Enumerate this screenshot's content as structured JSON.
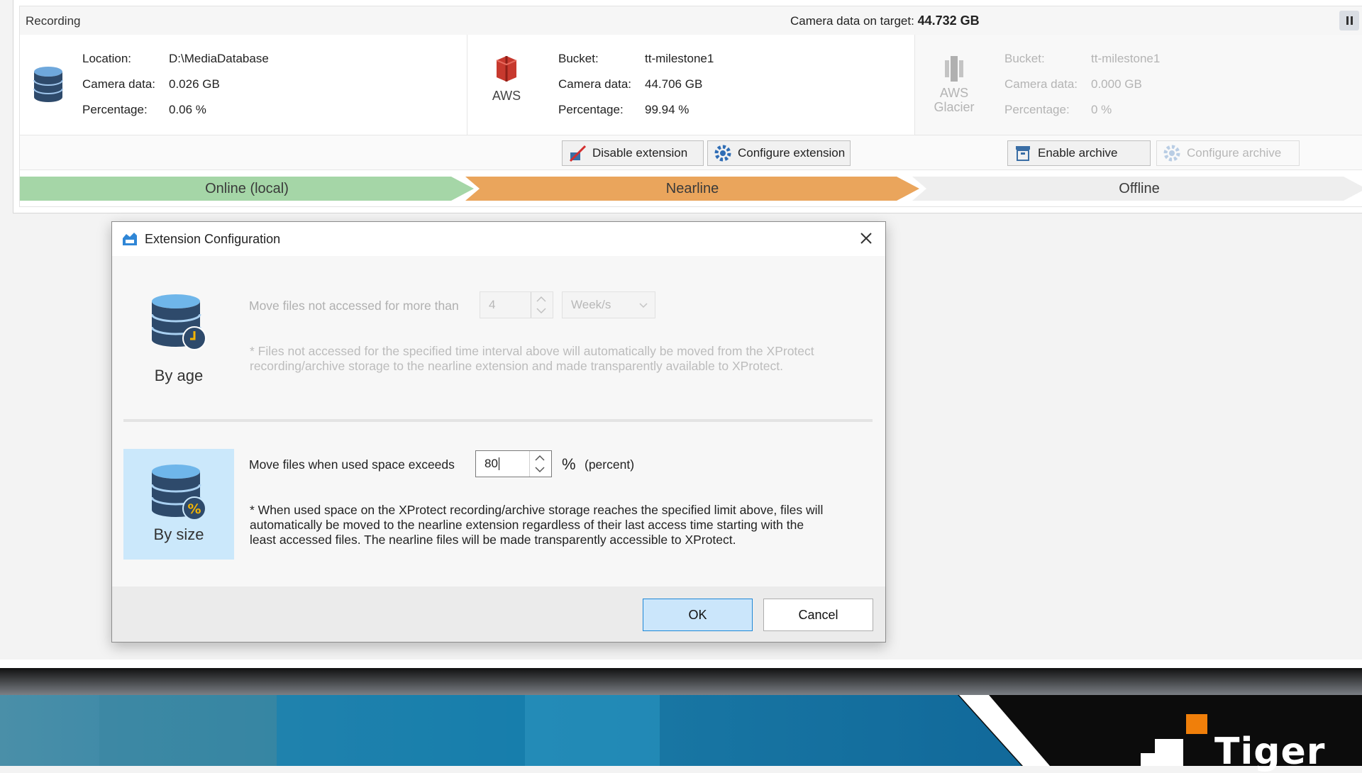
{
  "recording": {
    "title": "Recording",
    "total_label": "Camera data on target:",
    "total_value": "44.732 GB",
    "local": {
      "location_label": "Location:",
      "location_value": "D:\\MediaDatabase",
      "camera_label": "Camera data:",
      "camera_value": "0.026 GB",
      "pct_label": "Percentage:",
      "pct_value": "0.06 %"
    },
    "nearline": {
      "provider": "AWS",
      "bucket_label": "Bucket:",
      "bucket_value": "tt-milestone1",
      "camera_label": "Camera data:",
      "camera_value": "44.706 GB",
      "pct_label": "Percentage:",
      "pct_value": "99.94 %"
    },
    "offline": {
      "provider_line1": "AWS",
      "provider_line2": "Glacier",
      "bucket_label": "Bucket:",
      "bucket_value": "tt-milestone1",
      "camera_label": "Camera data:",
      "camera_value": "0.000 GB",
      "pct_label": "Percentage:",
      "pct_value": "0 %"
    },
    "buttons": {
      "disable_extension": "Disable extension",
      "configure_extension": "Configure extension",
      "enable_archive": "Enable archive",
      "configure_archive": "Configure archive"
    },
    "tiers": {
      "local": "Online (local)",
      "nearline": "Nearline",
      "offline": "Offline"
    },
    "colors": {
      "online": "#a5d6a7",
      "nearline": "#eaa55c",
      "offline": "#eeeeee"
    }
  },
  "dialog": {
    "title": "Extension Configuration",
    "by_age": {
      "label": "By age",
      "text": "Move files not accessed for more than",
      "value": "4",
      "unit": "Week/s",
      "note_line1": "* Files not accessed for the specified time interval above will automatically be moved from the XProtect",
      "note_line2": "recording/archive storage to the nearline extension and made transparently available to XProtect."
    },
    "by_size": {
      "label": "By size",
      "text": "Move files when used space exceeds",
      "value": "80",
      "unit_symbol": "%",
      "unit_text": "(percent)",
      "note_line1": "* When used space on the XProtect recording/archive storage reaches the specified limit above, files will",
      "note_line2": "automatically be moved to the nearline extension regardless of their last access time starting with the",
      "note_line3": "least accessed files. The nearline files will be made transparently accessible to XProtect."
    },
    "ok": "OK",
    "cancel": "Cancel"
  },
  "banner": {
    "brand": "Tiger"
  }
}
